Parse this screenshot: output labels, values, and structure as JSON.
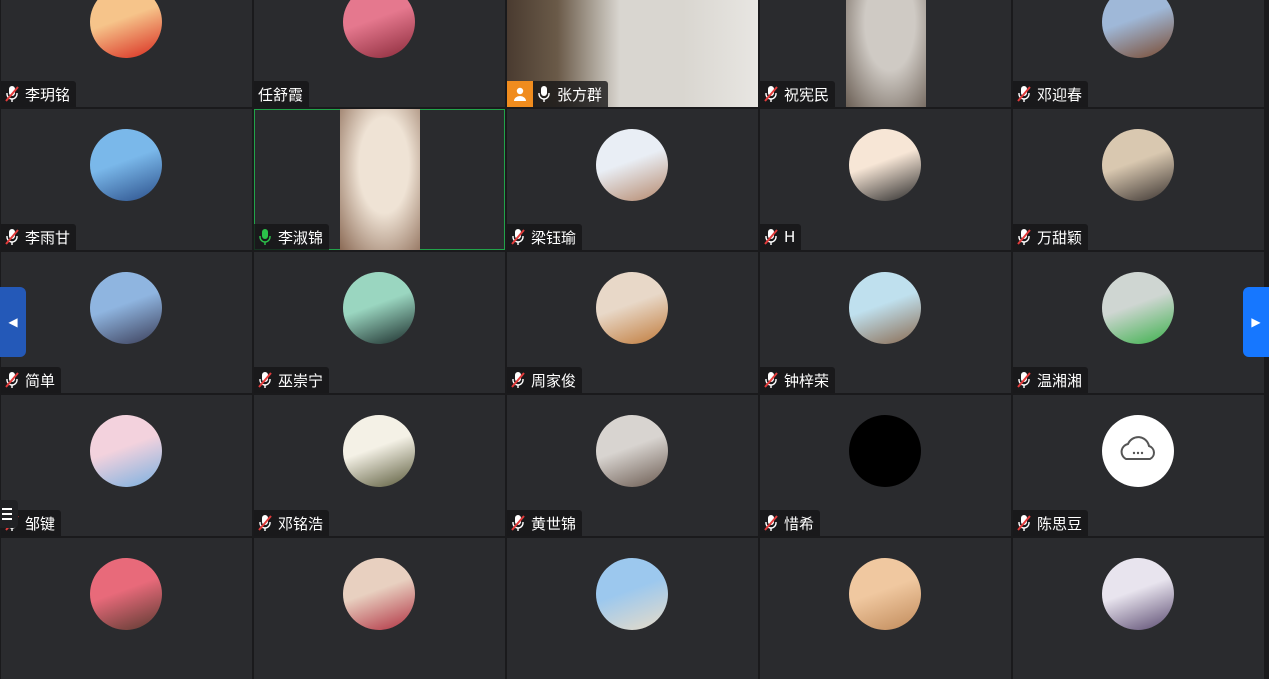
{
  "colors": {
    "tile_bg": "#2a2b2e",
    "grid_gap": "#1a1a1c",
    "speaking_border": "#22a34a",
    "host_badge": "#f08c1e",
    "nav_next": "#1677ff",
    "nav_prev": "#2459b8"
  },
  "navigation": {
    "prev_icon": "◀",
    "next_icon": "▶"
  },
  "participants": [
    {
      "name": "李玥铭",
      "mic": "muted",
      "view": "avatar",
      "avatar": "red-cartoon-room",
      "c": [
        "#f6c48a",
        "#d82a1e"
      ]
    },
    {
      "name": "任舒霞",
      "mic": "none",
      "view": "avatar",
      "avatar": "pink-bear",
      "c": [
        "#e5788e",
        "#8a2a3a"
      ]
    },
    {
      "name": "张方群",
      "mic": "on-white",
      "view": "video-wide",
      "host": true,
      "c": [
        "#d9d6d0",
        "#4a4744"
      ]
    },
    {
      "name": "祝宪民",
      "mic": "muted",
      "view": "video",
      "c": [
        "#cfcac4",
        "#6a5e54"
      ]
    },
    {
      "name": "邓迎春",
      "mic": "muted",
      "view": "avatar",
      "avatar": "cathedral",
      "c": [
        "#9fb8d8",
        "#7a4a30"
      ]
    },
    {
      "name": "李雨甘",
      "mic": "muted",
      "view": "avatar",
      "avatar": "blue-hair",
      "c": [
        "#7ab8ea",
        "#2b4f8a"
      ]
    },
    {
      "name": "李淑锦",
      "mic": "on-green",
      "view": "video",
      "speaking": true,
      "c": [
        "#efe3d5",
        "#8b6a55"
      ]
    },
    {
      "name": "梁钰瑜",
      "mic": "muted",
      "view": "avatar",
      "avatar": "snow-landscape",
      "c": [
        "#e9eef5",
        "#b5886c"
      ]
    },
    {
      "name": "H",
      "mic": "muted",
      "view": "avatar",
      "avatar": "cartoon-boy",
      "c": [
        "#f7e6d6",
        "#2a2a2a"
      ]
    },
    {
      "name": "万甜颖",
      "mic": "muted",
      "view": "avatar",
      "avatar": "silhouette",
      "c": [
        "#d9c8b0",
        "#3a3330"
      ]
    },
    {
      "name": "简单",
      "mic": "muted",
      "view": "avatar",
      "avatar": "lake-sunset",
      "c": [
        "#8fb5e0",
        "#3a3d58"
      ]
    },
    {
      "name": "巫崇宁",
      "mic": "muted",
      "view": "avatar",
      "avatar": "glowing-figure",
      "c": [
        "#9ad6c0",
        "#1a2b2a"
      ]
    },
    {
      "name": "周家俊",
      "mic": "muted",
      "view": "avatar",
      "avatar": "cats",
      "c": [
        "#e8d8c8",
        "#c07a3a"
      ]
    },
    {
      "name": "钟梓荣",
      "mic": "muted",
      "view": "avatar",
      "avatar": "ape-cartoon",
      "c": [
        "#bfe0ee",
        "#8a6a50"
      ]
    },
    {
      "name": "温湘湘",
      "mic": "muted",
      "view": "avatar",
      "avatar": "green-figure",
      "c": [
        "#cfd6d2",
        "#3ab04a"
      ]
    },
    {
      "name": "邹键",
      "mic": "muted",
      "view": "avatar",
      "avatar": "anime-girl",
      "c": [
        "#f3d2dd",
        "#7ab0e0"
      ]
    },
    {
      "name": "邓铭浩",
      "mic": "muted",
      "view": "avatar",
      "avatar": "scientist-sketch",
      "c": [
        "#f4f1e6",
        "#5a5a3a"
      ]
    },
    {
      "name": "黄世锦",
      "mic": "muted",
      "view": "avatar",
      "avatar": "selfie",
      "c": [
        "#d8d4d0",
        "#6a5a50"
      ]
    },
    {
      "name": "惜希",
      "mic": "muted",
      "view": "avatar",
      "avatar": "black",
      "c": [
        "#000000",
        "#000000"
      ]
    },
    {
      "name": "陈思豆",
      "mic": "muted",
      "view": "avatar",
      "avatar": "cloud-icon",
      "c": [
        "#ffffff",
        "#ffffff"
      ]
    },
    {
      "name": "",
      "mic": "none",
      "view": "avatar",
      "avatar": "rose",
      "c": [
        "#e86a7a",
        "#5a3a30"
      ]
    },
    {
      "name": "",
      "mic": "none",
      "view": "avatar",
      "avatar": "girl-photo",
      "c": [
        "#e8d0c0",
        "#b03040"
      ]
    },
    {
      "name": "",
      "mic": "none",
      "view": "avatar",
      "avatar": "beach",
      "c": [
        "#9cc8ee",
        "#e8dcc8"
      ]
    },
    {
      "name": "",
      "mic": "none",
      "view": "avatar",
      "avatar": "cat-close",
      "c": [
        "#f0c8a0",
        "#c08a5a"
      ]
    },
    {
      "name": "",
      "mic": "none",
      "view": "avatar",
      "avatar": "anime-character",
      "c": [
        "#e8e4ee",
        "#5a4a70"
      ]
    }
  ]
}
